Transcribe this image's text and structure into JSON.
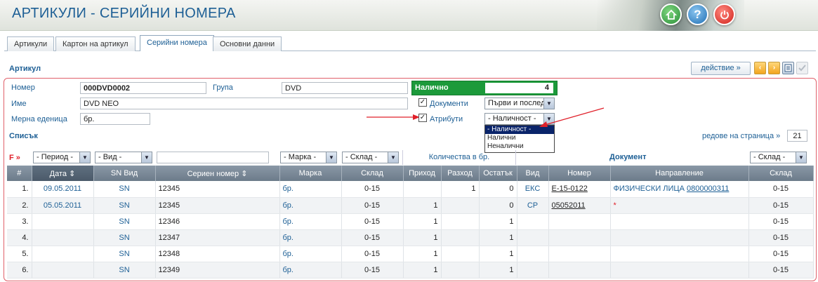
{
  "header": {
    "title": "АРТИКУЛИ - СЕРИЙНИ НОМЕРА"
  },
  "tabs": [
    {
      "label": "Артикули"
    },
    {
      "label": "Картон на артикул"
    },
    {
      "label": "Серийни номера"
    },
    {
      "label": "Основни данни"
    }
  ],
  "section": {
    "article": "Артикул",
    "list": "Списък"
  },
  "actions": {
    "action_label": "действие »"
  },
  "form": {
    "number_label": "Номер",
    "number_value": "000DVD0002",
    "group_label": "Група",
    "group_value": "DVD",
    "name_label": "Име",
    "name_value": "DVD NEO",
    "unit_label": "Мерна еденица",
    "unit_value": "бр.",
    "available_label": "Налично",
    "available_value": "4",
    "documents_label": "Документи",
    "documents_select": "Първи и послед",
    "attributes_label": "Атрибути",
    "availability_select": "- Наличност -"
  },
  "dropdown": {
    "options": [
      "- Наличност -",
      "Налични",
      "Неналични"
    ]
  },
  "pager": {
    "label": "редове на страница »",
    "value": "21"
  },
  "filters": {
    "f_label": "F »",
    "period": "- Период -",
    "kind": "- Вид -",
    "brand": "- Марка -",
    "warehouse": "- Склад -",
    "qty_label": "Количества в бр.",
    "doc_label": "Документ",
    "doc_warehouse": "- Склад -"
  },
  "columns": [
    "#",
    "Дата",
    "SN Вид",
    "Сериен номер",
    "Марка",
    "Склад",
    "Приход",
    "Разход",
    "Остатък",
    "Вид",
    "Номер",
    "Направление",
    "Склад"
  ],
  "rows": [
    {
      "n": "1.",
      "date": "09.05.2011",
      "sn": "SN",
      "serial": "12345",
      "brand": "бр.",
      "wh": "0-15",
      "in": "",
      "out": "1",
      "rest": "0",
      "dkind": "ЕКС",
      "dnum": "E-15-0122",
      "dir": "ФИЗИЧЕСКИ ЛИЦА",
      "dir_link": "0800000311",
      "dwh": "0-15"
    },
    {
      "n": "2.",
      "date": "05.05.2011",
      "sn": "SN",
      "serial": "12345",
      "brand": "бр.",
      "wh": "0-15",
      "in": "1",
      "out": "",
      "rest": "0",
      "dkind": "СР",
      "dnum": "05052011",
      "dir": "*",
      "dir_link": "",
      "dwh": "0-15"
    },
    {
      "n": "3.",
      "date": "",
      "sn": "SN",
      "serial": "12346",
      "brand": "бр.",
      "wh": "0-15",
      "in": "1",
      "out": "",
      "rest": "1",
      "dkind": "",
      "dnum": "",
      "dir": "",
      "dir_link": "",
      "dwh": "0-15"
    },
    {
      "n": "4.",
      "date": "",
      "sn": "SN",
      "serial": "12347",
      "brand": "бр.",
      "wh": "0-15",
      "in": "1",
      "out": "",
      "rest": "1",
      "dkind": "",
      "dnum": "",
      "dir": "",
      "dir_link": "",
      "dwh": "0-15"
    },
    {
      "n": "5.",
      "date": "",
      "sn": "SN",
      "serial": "12348",
      "brand": "бр.",
      "wh": "0-15",
      "in": "1",
      "out": "",
      "rest": "1",
      "dkind": "",
      "dnum": "",
      "dir": "",
      "dir_link": "",
      "dwh": "0-15"
    },
    {
      "n": "6.",
      "date": "",
      "sn": "SN",
      "serial": "12349",
      "brand": "бр.",
      "wh": "0-15",
      "in": "1",
      "out": "",
      "rest": "1",
      "dkind": "",
      "dnum": "",
      "dir": "",
      "dir_link": "",
      "dwh": "0-15"
    }
  ],
  "icons": {
    "home": "home-icon",
    "help": "help-icon",
    "power": "power-icon"
  },
  "colors": {
    "accent": "#1d5f95",
    "available_green": "#1c9a3a",
    "annotation_red": "#e0202a"
  }
}
